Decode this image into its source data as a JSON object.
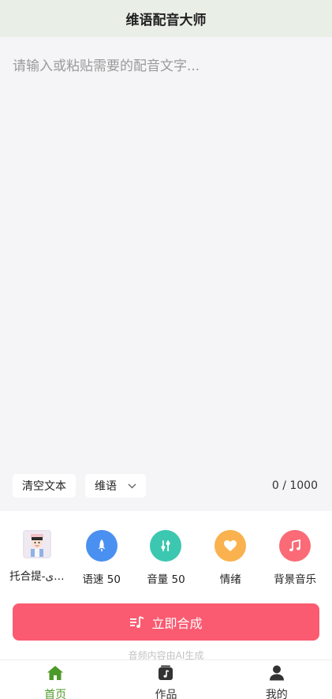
{
  "header": {
    "title": "维语配音大师"
  },
  "editor": {
    "placeholder": "请输入或粘贴需要的配音文字...",
    "value": ""
  },
  "tools": {
    "clear_label": "清空文本",
    "language_label": "维语",
    "counter": "0 / 1000"
  },
  "options": {
    "voice_label": "托合提-ی…",
    "speed_label": "语速 50",
    "volume_label": "音量 50",
    "emotion_label": "情绪",
    "music_label": "背景音乐"
  },
  "colors": {
    "speed": "#4a90f0",
    "volume": "#3cc7b0",
    "emotion": "#f9b24e",
    "music": "#fa6b77",
    "primary": "#fa5b70",
    "tab_active": "#4c9a2a"
  },
  "synth": {
    "label": "立即合成"
  },
  "notice": "音频内容由AI生成",
  "tabs": [
    {
      "label": "首页",
      "icon": "home-icon",
      "active": true
    },
    {
      "label": "作品",
      "icon": "works-icon",
      "active": false
    },
    {
      "label": "我的",
      "icon": "user-icon",
      "active": false
    }
  ]
}
